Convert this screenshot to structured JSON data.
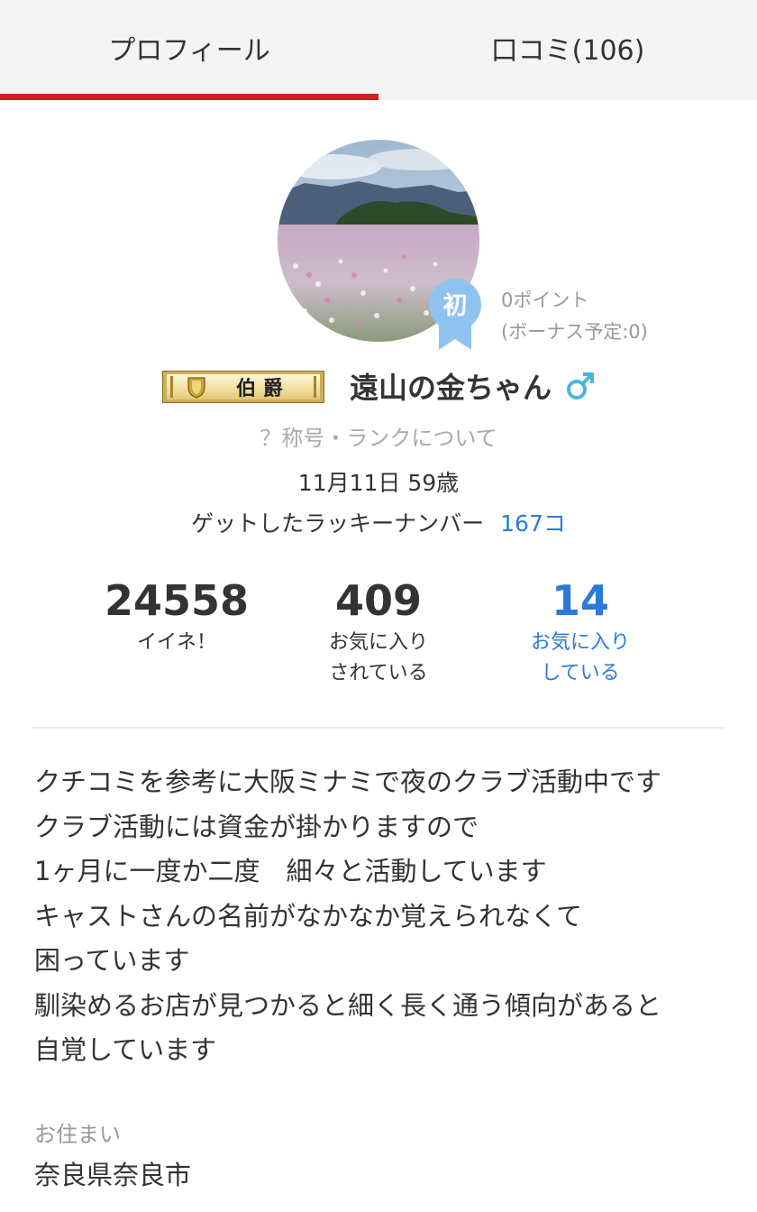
{
  "tabs": [
    {
      "label": "プロフィール",
      "active": true
    },
    {
      "label": "口コミ(106)",
      "active": false
    }
  ],
  "colors": {
    "accent": "#d0211c",
    "link": "#2a7bd6",
    "badge": "#8ec3f0"
  },
  "profile": {
    "badge_text": "初",
    "points": "0ポイント",
    "bonus": "(ボーナス予定:0)",
    "rank_title": "伯 爵",
    "username": "遠山の金ちゃん",
    "gender_icon": "male-icon",
    "rank_link": "？称号・ランクについて",
    "birthday_age": "11月11日 59歳",
    "lucky_label": "ゲットしたラッキーナンバー",
    "lucky_count": "167コ"
  },
  "stats": [
    {
      "value": "24558",
      "label_lines": [
        "イイネ！"
      ]
    },
    {
      "value": "409",
      "label_lines": [
        "お気に入り",
        "されている"
      ]
    },
    {
      "value": "14",
      "label_lines": [
        "お気に入り",
        "している"
      ]
    }
  ],
  "bio_lines": [
    "クチコミを参考に大阪ミナミで夜のクラブ活動中です",
    "クラブ活動には資金が掛かりますので",
    "1ヶ月に一度か二度　細々と活動しています",
    "キャストさんの名前がなかなか覚えられなくて",
    "困っています",
    "馴染めるお店が見つかると細く長く通う傾向があると",
    "自覚しています"
  ],
  "residence": {
    "label": "お住まい",
    "value": "奈良県奈良市"
  }
}
